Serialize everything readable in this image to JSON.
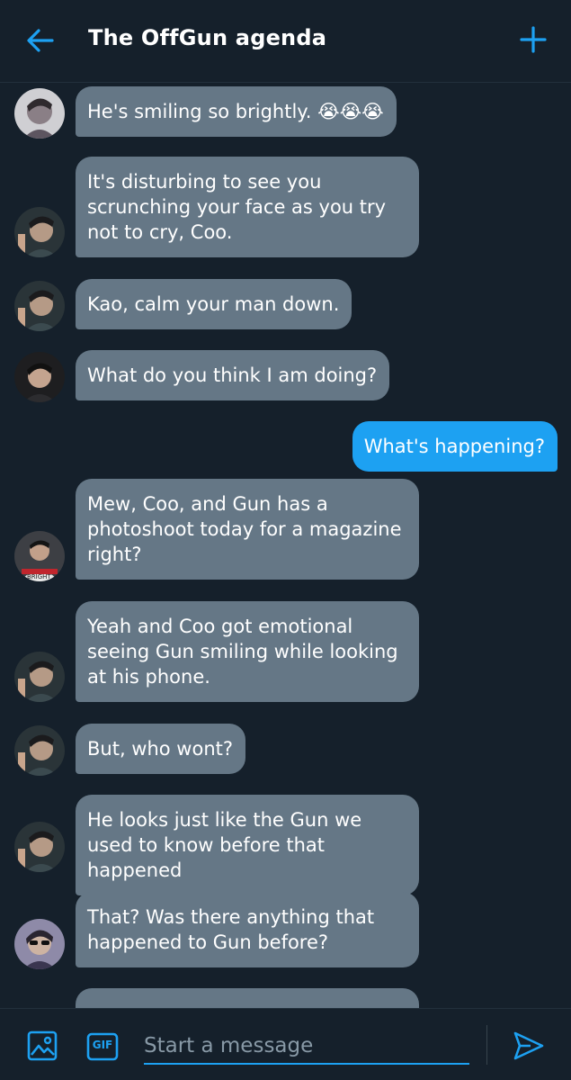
{
  "header": {
    "title": "The OffGun agenda",
    "back_icon": "arrow-left-icon",
    "add_icon": "plus-icon",
    "accent": "#1da1f2"
  },
  "messages": [
    {
      "direction": "in",
      "text": "He's smiling so brightly. 😭😭😭"
    },
    {
      "direction": "in",
      "text": "It's disturbing to see you scrunching your face as you try not to cry, Coo."
    },
    {
      "direction": "in",
      "text": "Kao, calm your man down."
    },
    {
      "direction": "in",
      "text": "What do you think I am doing?"
    },
    {
      "direction": "out",
      "text": "What's happening?"
    },
    {
      "direction": "in",
      "text": "Mew, Coo, and Gun has a photoshoot today for a magazine right?"
    },
    {
      "direction": "in",
      "text": "Yeah and Coo got emotional seeing Gun smiling while looking at his phone."
    },
    {
      "direction": "in",
      "text": "But, who wont?"
    },
    {
      "direction": "in",
      "text": "He looks just like the Gun we used to know before that happened"
    },
    {
      "direction": "in",
      "text": "That? Was there anything that happened to Gun before?"
    }
  ],
  "composer": {
    "placeholder": "Start a message",
    "media_icon": "image-icon",
    "gif_label": "GIF",
    "send_icon": "send-icon"
  },
  "colors": {
    "background": "#15202b",
    "incoming_bubble": "#657786",
    "outgoing_bubble": "#1da1f2"
  }
}
